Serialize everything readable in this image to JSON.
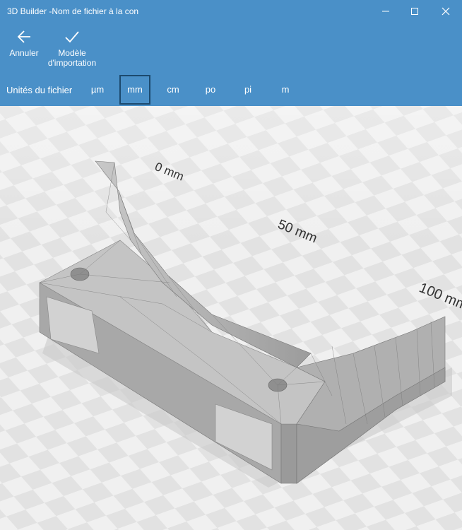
{
  "window": {
    "title": "3D Builder -Nom de fichier à la con"
  },
  "toolbar": {
    "cancel_label": "Annuler",
    "import_label": "Modèle d'importation"
  },
  "units": {
    "label": "Unités du fichier",
    "options": [
      "µm",
      "mm",
      "cm",
      "po",
      "pi",
      "m"
    ],
    "selected": "mm"
  },
  "viewport": {
    "ruler_labels": [
      "0 mm",
      "50 mm",
      "100 mm"
    ]
  },
  "colors": {
    "accent": "#4a90c8",
    "selected_border": "#1c4a6e",
    "floor_light": "#f2f2f2",
    "floor_dark": "#e4e4e4",
    "model": "#b4b4b4"
  }
}
